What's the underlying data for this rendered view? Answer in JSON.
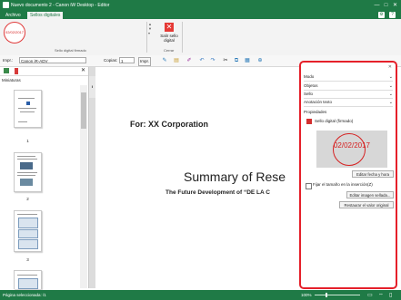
{
  "window": {
    "title": "Nuevo documento 2 - Canon iW Desktop - Editor",
    "controls": [
      "—",
      "□",
      "✕"
    ]
  },
  "ribbon": {
    "tabs": [
      "Archivo",
      "Sellos digitales"
    ],
    "stamp_thumb_date": "02/02/2017",
    "group_digital_stamp": "Sello digital firmado",
    "close_stamp_label": "Salir sello digital",
    "group_close": "Cerrar"
  },
  "toolbar": {
    "print_label": "Impr.:",
    "printer": "Canon iR-ADV",
    "copies_label": "Copias:",
    "copies_value": "1",
    "print_button": "Impr."
  },
  "left_panel": {
    "title": "Miniaturas",
    "pages": [
      "1",
      "2",
      "3"
    ]
  },
  "document": {
    "for_line": "For: XX Corporation",
    "summary_line": "Summary of Rese",
    "future_line": "The Future Development of “DE LA C"
  },
  "right_panel": {
    "rows": [
      {
        "label": "Modo"
      },
      {
        "label": "Objetos"
      },
      {
        "label": "Sello"
      },
      {
        "label": "Anotación texto"
      }
    ],
    "properties_label": "Propiedades",
    "stamp_name": "Sello digital (firmado)",
    "stamp_date": "02/02/2017",
    "edit_date_button": "Editar fecha y hora",
    "fix_size_label": "Fijar el tamaño en la inserción(Z)",
    "edit_image_button": "Editar imagen sellada...",
    "restore_button": "Restaurar el valor original"
  },
  "statusbar": {
    "text": "Página seleccionada: /1",
    "zoom": "100%"
  },
  "colors": {
    "brand_green": "#1f7a46",
    "highlight_red": "#e5202a"
  }
}
